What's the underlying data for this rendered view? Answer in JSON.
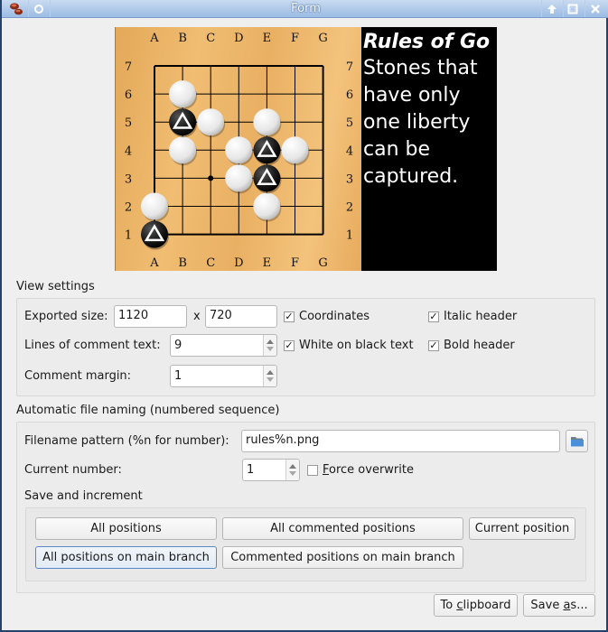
{
  "window": {
    "title": "Form",
    "controls": [
      "shade",
      "maximize",
      "close"
    ]
  },
  "board": {
    "columns": [
      "A",
      "B",
      "C",
      "D",
      "E",
      "F",
      "G"
    ],
    "rows": [
      "7",
      "6",
      "5",
      "4",
      "3",
      "2",
      "1"
    ],
    "hoshi": [
      "C3"
    ],
    "white_stones": [
      "B6",
      "C5",
      "B4",
      "E5",
      "D4",
      "F4",
      "D3",
      "E2",
      "A2"
    ],
    "black_stones": [
      "B5",
      "E4",
      "E3",
      "A1"
    ],
    "marked_triangle": [
      "B5",
      "E4",
      "E3",
      "A1"
    ],
    "colors": {
      "wood": "#eeb56a",
      "line": "#000000",
      "white_stone": "#f2f2f2",
      "black_stone": "#1a1a1a"
    }
  },
  "comment": {
    "header": "Rules of Go",
    "lines": [
      "Stones that",
      "have only",
      "one liberty",
      "can be",
      "captured."
    ]
  },
  "view_settings": {
    "title": "View settings",
    "exported_size_label": "Exported size:",
    "width_value": "1120",
    "x_label": "x",
    "height_value": "720",
    "lines_label": "Lines of comment text:",
    "lines_value": "9",
    "margin_label": "Comment margin:",
    "margin_value": "1",
    "coordinates": {
      "label": "Coordinates",
      "checked": true
    },
    "white_on_black": {
      "label": "White on black text",
      "checked": true
    },
    "italic_header": {
      "label": "Italic header",
      "checked": true
    },
    "bold_header": {
      "label": "Bold header",
      "checked": true
    }
  },
  "file_naming": {
    "title": "Automatic file naming (numbered sequence)",
    "pattern_label": "Filename pattern (%n for number):",
    "pattern_value": "rules%n.png",
    "current_label": "Current number:",
    "current_value": "1",
    "force_overwrite": {
      "label_mnemonic": "F",
      "label_rest": "orce overwrite",
      "checked": false
    },
    "save_increment_label": "Save and increment",
    "buttons": {
      "all_positions": "All positions",
      "all_commented": "All commented positions",
      "current_position": "Current position",
      "all_main_branch": "All positions on main branch",
      "commented_main_branch": "Commented positions on main branch"
    }
  },
  "footer": {
    "clipboard_pre": "To ",
    "clipboard_mn": "c",
    "clipboard_post": "lipboard",
    "saveas_pre": "Save ",
    "saveas_mn": "a",
    "saveas_post": "s..."
  }
}
